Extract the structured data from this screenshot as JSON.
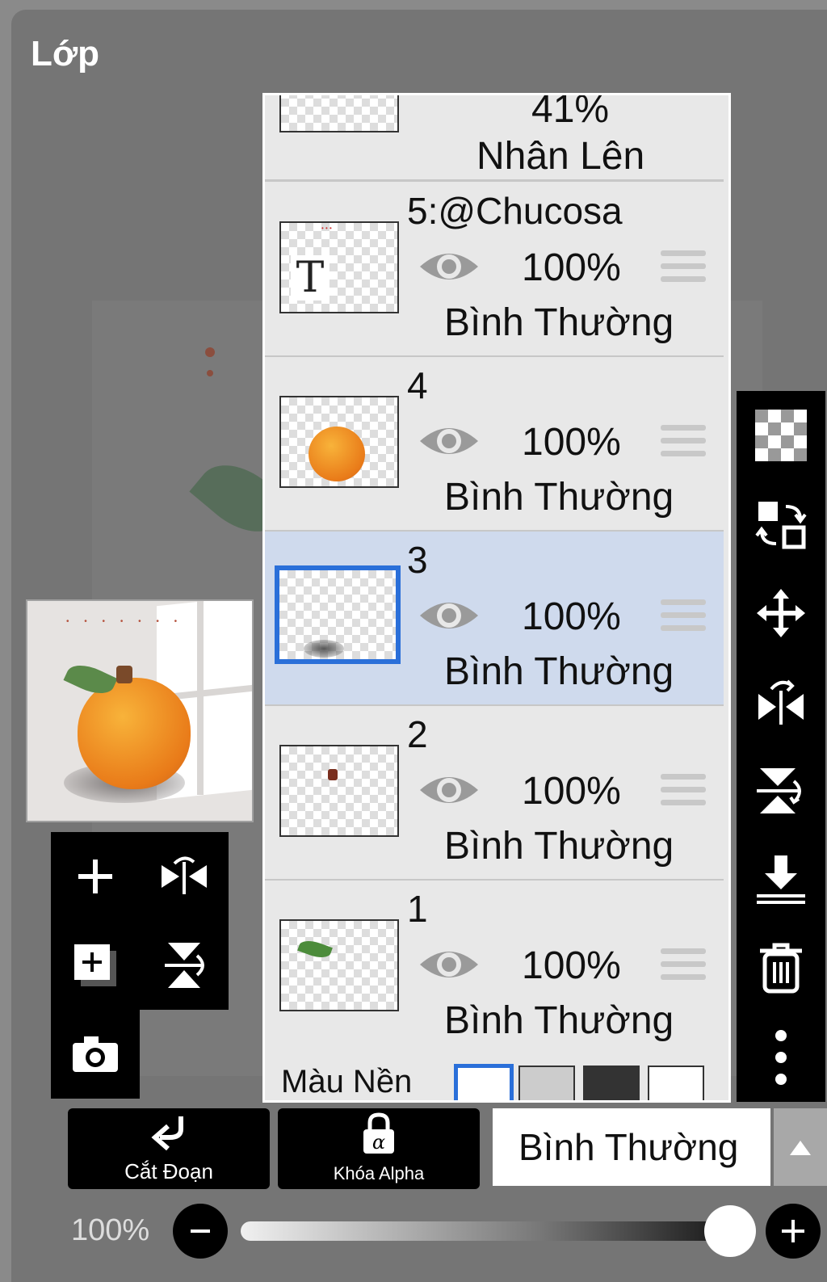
{
  "header": {
    "title": "Lớp"
  },
  "layers_partial_top": {
    "opacity": "41%",
    "blend": "Nhân Lên"
  },
  "layers": [
    {
      "name": "5:@Chucosa",
      "opacity": "100%",
      "blend": "Bình Thường",
      "type": "text",
      "selected": false
    },
    {
      "name": "4",
      "opacity": "100%",
      "blend": "Bình Thường",
      "type": "peach",
      "selected": false
    },
    {
      "name": "3",
      "opacity": "100%",
      "blend": "Bình Thường",
      "type": "shadow",
      "selected": true
    },
    {
      "name": "2",
      "opacity": "100%",
      "blend": "Bình Thường",
      "type": "stem",
      "selected": false
    },
    {
      "name": "1",
      "opacity": "100%",
      "blend": "Bình Thường",
      "type": "leaf",
      "selected": false
    }
  ],
  "background_row": {
    "label": "Màu Nền"
  },
  "text_layer_glyph": "T",
  "bottom": {
    "clip_label": "Cắt Đoạn",
    "alpha_lock_label": "Khóa Alpha",
    "alpha_symbol": "α",
    "blend_mode": "Bình Thường"
  },
  "zoom": {
    "value": "100%"
  },
  "colors": {
    "selected_layer": "#cfdaed",
    "selection_border": "#2a6fd9"
  }
}
